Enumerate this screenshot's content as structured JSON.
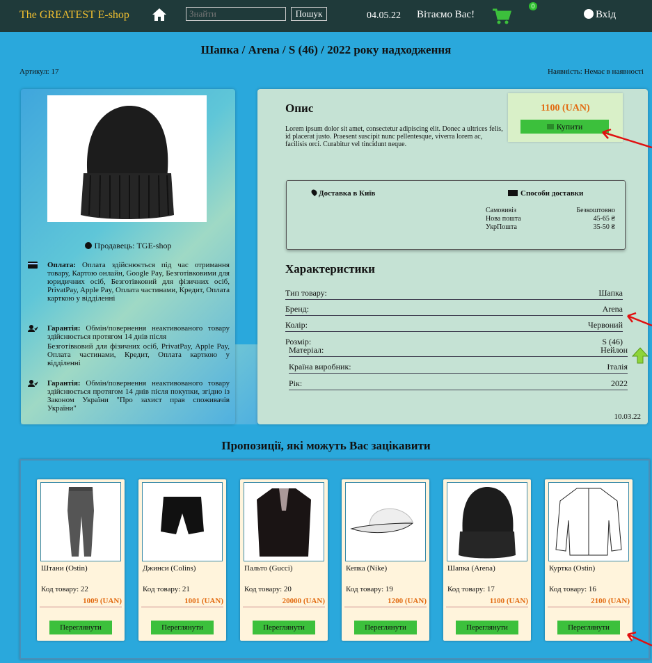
{
  "header": {
    "brand": "The GREATEST E-shop",
    "search_placeholder": "Знайти",
    "search_button": "Пошук",
    "date": "04.05.22",
    "greeting": "Вітаємо Вас!",
    "cart_count": "0",
    "login": "Вхід"
  },
  "product": {
    "title": "Шапка / Arena / S (46) / 2022 року надходження",
    "article": "Артикул: 17",
    "availability": "Наявність: Немає в наявності",
    "seller": "Продавець: TGE-shop",
    "payment_label": "Оплата:",
    "payment_text": "Оплата здійснюється під час отримання товару, Картою онлайн, Google Pay, Безготівковими для юридичних осіб, Безготівковий для фізичних осіб, PrivatPay, Apple Pay, Оплата частинами, Кредит, Оплата карткою у відділенні",
    "warranty_label": "Гарантія:",
    "warranty_text_1": "Обмін/повернення неактивованого товару здійснюється протягом 14 днів після",
    "warranty_text_1b": "Безготівковий для фізичних осіб, PrivatPay, Apple Pay, Оплата частинами, Кредит, Оплата карткою у відділенні",
    "warranty_text_2": "Обмін/повернення неактивованого товару здійснюється протягом 14 днів після покупки, згідно із Законом України \"Про захист прав споживачів України\"",
    "description_title": "Опис",
    "description": "Lorem ipsum dolor sit amet, consectetur adipiscing elit. Donec a ultrices felis, id placerat justo. Praesent suscipit nunc pellentesque, viverra lorem ac, facilisis orci. Curabitur vel tincidunt neque.",
    "price": "1100 (UAN)",
    "buy_button": "Купити",
    "delivery_city": "Доставка в Київ",
    "delivery_methods_title": "Способи доставки",
    "delivery_methods": [
      {
        "name": "Самовивіз",
        "price": "Безкоштовно"
      },
      {
        "name": "Нова пошта",
        "price": "45-65 ₴"
      },
      {
        "name": "УкрПошта",
        "price": "35-50 ₴"
      }
    ],
    "characteristics_title": "Характеристики",
    "characteristics": [
      {
        "key": "Тип товару:",
        "value": "Шапка"
      },
      {
        "key": "Бренд:",
        "value": "Arena"
      },
      {
        "key": "Колір:",
        "value": "Червоний"
      },
      {
        "key": "Розмір:",
        "value": "S (46)"
      }
    ],
    "characteristics_2": [
      {
        "key": "Матеріал:",
        "value": "Нейлон"
      },
      {
        "key": "Країна виробник:",
        "value": "Італія"
      },
      {
        "key": "Рік:",
        "value": "2022"
      }
    ],
    "added_date": "10.03.22"
  },
  "suggestions": {
    "title": "Пропозиції, які можуть Вас зацікавити",
    "items": [
      {
        "name": "Штани (Ostin)",
        "code": "Код товару: 22",
        "price": "1009 (UAN)",
        "button": "Переглянути",
        "image": "pants"
      },
      {
        "name": "Джинси (Colins)",
        "code": "Код товару: 21",
        "price": "1001 (UAN)",
        "button": "Переглянути",
        "image": "shorts"
      },
      {
        "name": "Пальто (Gucci)",
        "code": "Код товару: 20",
        "price": "20000 (UAN)",
        "button": "Переглянути",
        "image": "coat"
      },
      {
        "name": "Кепка (Nike)",
        "code": "Код товару: 19",
        "price": "1200 (UAN)",
        "button": "Переглянути",
        "image": "cap"
      },
      {
        "name": "Шапка (Arena)",
        "code": "Код товару: 17",
        "price": "1100 (UAN)",
        "button": "Переглянути",
        "image": "beanie"
      },
      {
        "name": "Куртка (Ostin)",
        "code": "Код товару: 16",
        "price": "2100 (UAN)",
        "button": "Переглянути",
        "image": "jacket"
      }
    ]
  },
  "colors": {
    "header_bg": "#1f3a3a",
    "page_bg": "#2aa8dc",
    "accent_green": "#3cc03c",
    "price_orange": "#e26a10",
    "annotation_red": "#e01010"
  }
}
